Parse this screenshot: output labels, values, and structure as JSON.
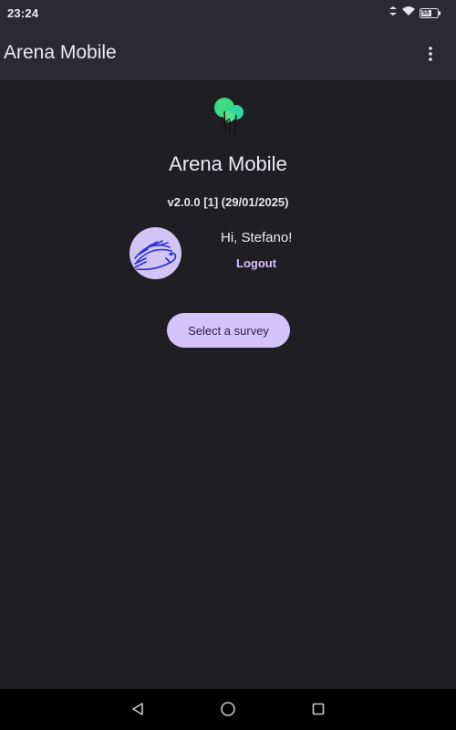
{
  "status_bar": {
    "time": "23:24",
    "battery_level": "55",
    "icons": [
      "vibrate-icon",
      "wifi-icon",
      "battery-icon"
    ]
  },
  "app_bar": {
    "title": "Arena Mobile",
    "menu_icon": "more-vert-icon"
  },
  "home": {
    "logo": "arena-trees-logo",
    "title": "Arena Mobile",
    "version": "v2.0.0 [1] (29/01/2025)",
    "avatar": "porcupine-avatar",
    "greeting": "Hi, Stefano!",
    "logout_label": "Logout",
    "select_survey_label": "Select a survey"
  },
  "nav_bar": {
    "back": "back-triangle-icon",
    "home": "home-circle-icon",
    "recents": "recents-square-icon"
  },
  "colors": {
    "background": "#1f1e22",
    "app_bar": "#2b2a30",
    "accent": "#d2c3fb",
    "link": "#d3c3ff",
    "logo_green": "#3ddc84"
  }
}
